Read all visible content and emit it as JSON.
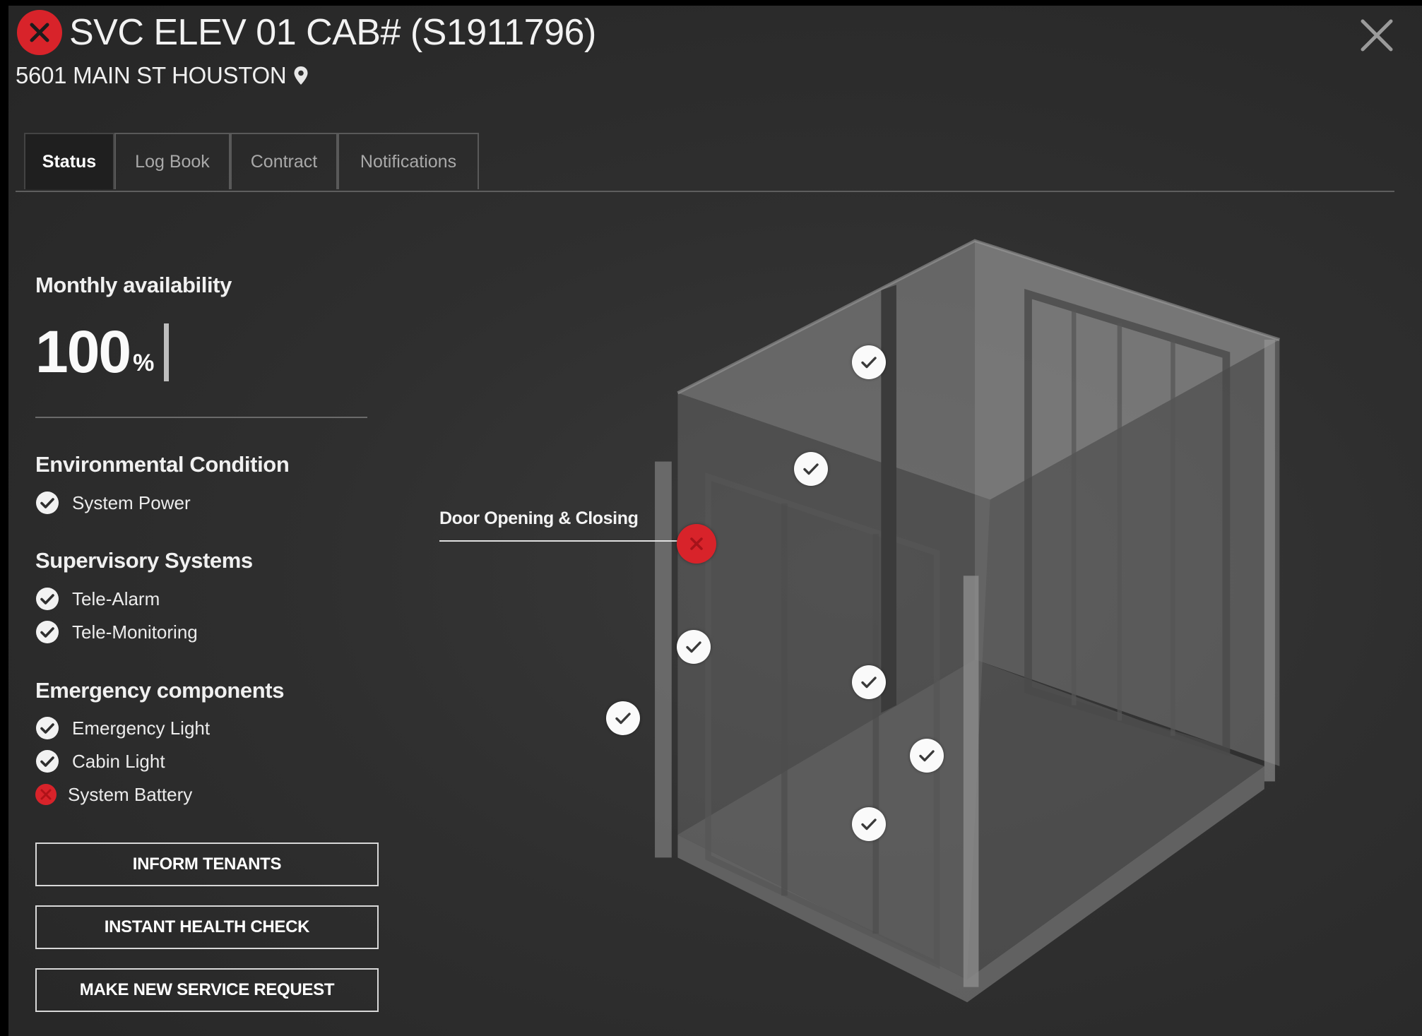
{
  "header": {
    "status": "fault",
    "title": "SVC ELEV 01 CAB# (S1911796)",
    "address": "5601 MAIN ST HOUSTON"
  },
  "tabs": [
    {
      "label": "Status",
      "active": true
    },
    {
      "label": "Log Book",
      "active": false
    },
    {
      "label": "Contract",
      "active": false
    },
    {
      "label": "Notifications",
      "active": false
    }
  ],
  "availability": {
    "heading": "Monthly availability",
    "value": "100",
    "unit": "%"
  },
  "sections": {
    "environmental": {
      "heading": "Environmental Condition",
      "items": [
        {
          "label": "System Power",
          "status": "ok"
        }
      ]
    },
    "supervisory": {
      "heading": "Supervisory Systems",
      "items": [
        {
          "label": "Tele-Alarm",
          "status": "ok"
        },
        {
          "label": "Tele-Monitoring",
          "status": "ok"
        }
      ]
    },
    "emergency": {
      "heading": "Emergency components",
      "items": [
        {
          "label": "Emergency Light",
          "status": "ok"
        },
        {
          "label": "Cabin Light",
          "status": "ok"
        },
        {
          "label": "System Battery",
          "status": "fail"
        }
      ]
    }
  },
  "actions": {
    "inform": "INFORM TENANTS",
    "health": "INSTANT HEALTH CHECK",
    "service": "MAKE NEW SERVICE REQUEST"
  },
  "cab_view": {
    "callout": "Door Opening & Closing",
    "markers": [
      {
        "status": "ok"
      },
      {
        "status": "ok"
      },
      {
        "status": "fail"
      },
      {
        "status": "ok"
      },
      {
        "status": "ok"
      },
      {
        "status": "ok"
      },
      {
        "status": "ok"
      },
      {
        "status": "ok"
      }
    ]
  },
  "colors": {
    "fail": "#d8232a",
    "ok": "#fafafa",
    "background": "#2e2e2e"
  },
  "icons": {
    "ok": "check-circle-icon",
    "fail": "x-circle-icon",
    "location": "map-pin-icon",
    "close": "close-icon"
  }
}
